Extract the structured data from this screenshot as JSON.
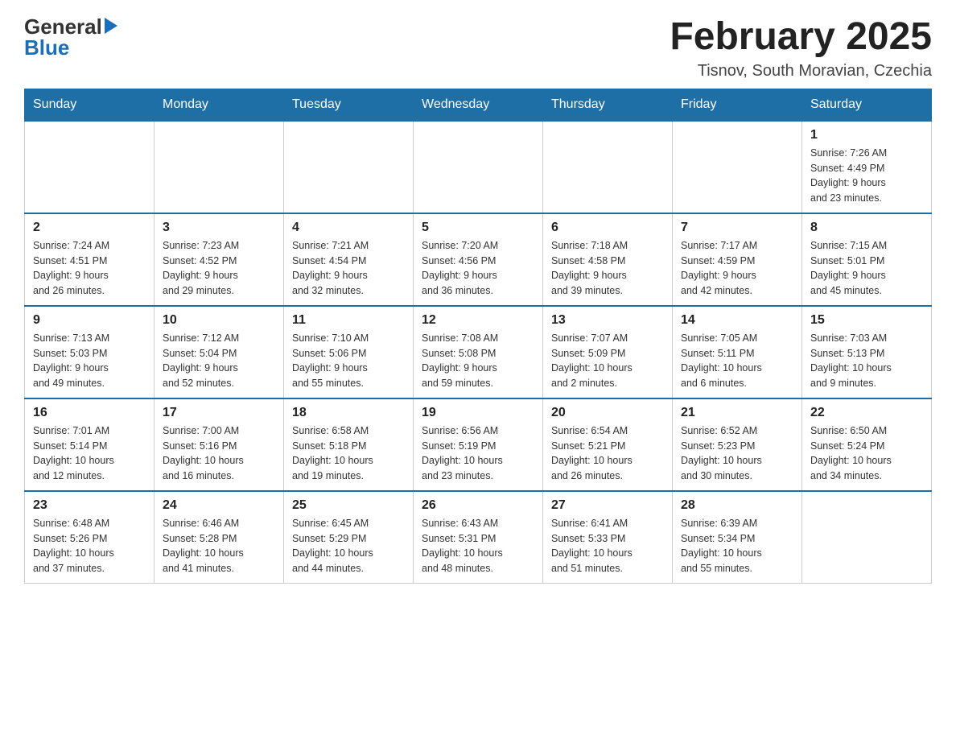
{
  "header": {
    "logo_general": "General",
    "logo_blue": "Blue",
    "month_title": "February 2025",
    "location": "Tisnov, South Moravian, Czechia"
  },
  "weekdays": [
    "Sunday",
    "Monday",
    "Tuesday",
    "Wednesday",
    "Thursday",
    "Friday",
    "Saturday"
  ],
  "weeks": [
    {
      "days": [
        {
          "num": "",
          "info": ""
        },
        {
          "num": "",
          "info": ""
        },
        {
          "num": "",
          "info": ""
        },
        {
          "num": "",
          "info": ""
        },
        {
          "num": "",
          "info": ""
        },
        {
          "num": "",
          "info": ""
        },
        {
          "num": "1",
          "info": "Sunrise: 7:26 AM\nSunset: 4:49 PM\nDaylight: 9 hours\nand 23 minutes."
        }
      ]
    },
    {
      "days": [
        {
          "num": "2",
          "info": "Sunrise: 7:24 AM\nSunset: 4:51 PM\nDaylight: 9 hours\nand 26 minutes."
        },
        {
          "num": "3",
          "info": "Sunrise: 7:23 AM\nSunset: 4:52 PM\nDaylight: 9 hours\nand 29 minutes."
        },
        {
          "num": "4",
          "info": "Sunrise: 7:21 AM\nSunset: 4:54 PM\nDaylight: 9 hours\nand 32 minutes."
        },
        {
          "num": "5",
          "info": "Sunrise: 7:20 AM\nSunset: 4:56 PM\nDaylight: 9 hours\nand 36 minutes."
        },
        {
          "num": "6",
          "info": "Sunrise: 7:18 AM\nSunset: 4:58 PM\nDaylight: 9 hours\nand 39 minutes."
        },
        {
          "num": "7",
          "info": "Sunrise: 7:17 AM\nSunset: 4:59 PM\nDaylight: 9 hours\nand 42 minutes."
        },
        {
          "num": "8",
          "info": "Sunrise: 7:15 AM\nSunset: 5:01 PM\nDaylight: 9 hours\nand 45 minutes."
        }
      ]
    },
    {
      "days": [
        {
          "num": "9",
          "info": "Sunrise: 7:13 AM\nSunset: 5:03 PM\nDaylight: 9 hours\nand 49 minutes."
        },
        {
          "num": "10",
          "info": "Sunrise: 7:12 AM\nSunset: 5:04 PM\nDaylight: 9 hours\nand 52 minutes."
        },
        {
          "num": "11",
          "info": "Sunrise: 7:10 AM\nSunset: 5:06 PM\nDaylight: 9 hours\nand 55 minutes."
        },
        {
          "num": "12",
          "info": "Sunrise: 7:08 AM\nSunset: 5:08 PM\nDaylight: 9 hours\nand 59 minutes."
        },
        {
          "num": "13",
          "info": "Sunrise: 7:07 AM\nSunset: 5:09 PM\nDaylight: 10 hours\nand 2 minutes."
        },
        {
          "num": "14",
          "info": "Sunrise: 7:05 AM\nSunset: 5:11 PM\nDaylight: 10 hours\nand 6 minutes."
        },
        {
          "num": "15",
          "info": "Sunrise: 7:03 AM\nSunset: 5:13 PM\nDaylight: 10 hours\nand 9 minutes."
        }
      ]
    },
    {
      "days": [
        {
          "num": "16",
          "info": "Sunrise: 7:01 AM\nSunset: 5:14 PM\nDaylight: 10 hours\nand 12 minutes."
        },
        {
          "num": "17",
          "info": "Sunrise: 7:00 AM\nSunset: 5:16 PM\nDaylight: 10 hours\nand 16 minutes."
        },
        {
          "num": "18",
          "info": "Sunrise: 6:58 AM\nSunset: 5:18 PM\nDaylight: 10 hours\nand 19 minutes."
        },
        {
          "num": "19",
          "info": "Sunrise: 6:56 AM\nSunset: 5:19 PM\nDaylight: 10 hours\nand 23 minutes."
        },
        {
          "num": "20",
          "info": "Sunrise: 6:54 AM\nSunset: 5:21 PM\nDaylight: 10 hours\nand 26 minutes."
        },
        {
          "num": "21",
          "info": "Sunrise: 6:52 AM\nSunset: 5:23 PM\nDaylight: 10 hours\nand 30 minutes."
        },
        {
          "num": "22",
          "info": "Sunrise: 6:50 AM\nSunset: 5:24 PM\nDaylight: 10 hours\nand 34 minutes."
        }
      ]
    },
    {
      "days": [
        {
          "num": "23",
          "info": "Sunrise: 6:48 AM\nSunset: 5:26 PM\nDaylight: 10 hours\nand 37 minutes."
        },
        {
          "num": "24",
          "info": "Sunrise: 6:46 AM\nSunset: 5:28 PM\nDaylight: 10 hours\nand 41 minutes."
        },
        {
          "num": "25",
          "info": "Sunrise: 6:45 AM\nSunset: 5:29 PM\nDaylight: 10 hours\nand 44 minutes."
        },
        {
          "num": "26",
          "info": "Sunrise: 6:43 AM\nSunset: 5:31 PM\nDaylight: 10 hours\nand 48 minutes."
        },
        {
          "num": "27",
          "info": "Sunrise: 6:41 AM\nSunset: 5:33 PM\nDaylight: 10 hours\nand 51 minutes."
        },
        {
          "num": "28",
          "info": "Sunrise: 6:39 AM\nSunset: 5:34 PM\nDaylight: 10 hours\nand 55 minutes."
        },
        {
          "num": "",
          "info": ""
        }
      ]
    }
  ]
}
